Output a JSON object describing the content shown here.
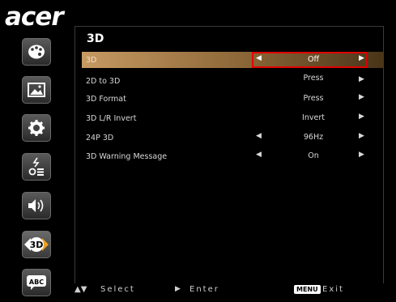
{
  "brand": {
    "logo_text": "acer"
  },
  "sidebar": {
    "items": [
      {
        "name": "picture-icon",
        "active": false
      },
      {
        "name": "image-icon",
        "active": false
      },
      {
        "name": "gear-icon",
        "active": false
      },
      {
        "name": "power-icon",
        "active": false
      },
      {
        "name": "speaker-icon",
        "active": false
      },
      {
        "name": "3d-icon",
        "label": "3D",
        "active": true
      },
      {
        "name": "abc-icon",
        "label": "ABC",
        "active": false
      }
    ]
  },
  "menu": {
    "title": "3D",
    "rows": [
      {
        "label": "3D",
        "value": "Off",
        "left_arrow": true,
        "right_arrow": true,
        "selected": true
      },
      {
        "label": "2D to 3D",
        "value": "Press",
        "left_arrow": false,
        "right_arrow": true,
        "selected": false
      },
      {
        "label": "3D Format",
        "value": "Press",
        "left_arrow": false,
        "right_arrow": true,
        "selected": false
      },
      {
        "label": "3D L/R Invert",
        "value": "Invert",
        "left_arrow": false,
        "right_arrow": true,
        "selected": false
      },
      {
        "label": "24P 3D",
        "value": "96Hz",
        "left_arrow": true,
        "right_arrow": true,
        "selected": false
      },
      {
        "label": "3D Warning Message",
        "value": "On",
        "left_arrow": true,
        "right_arrow": true,
        "selected": false
      }
    ]
  },
  "footer": {
    "select_label": "Select",
    "enter_label": "Enter",
    "menu_badge": "MENU",
    "exit_label": "Exit"
  },
  "colors": {
    "highlight": "#c79a62",
    "selection_border": "#e00000"
  }
}
